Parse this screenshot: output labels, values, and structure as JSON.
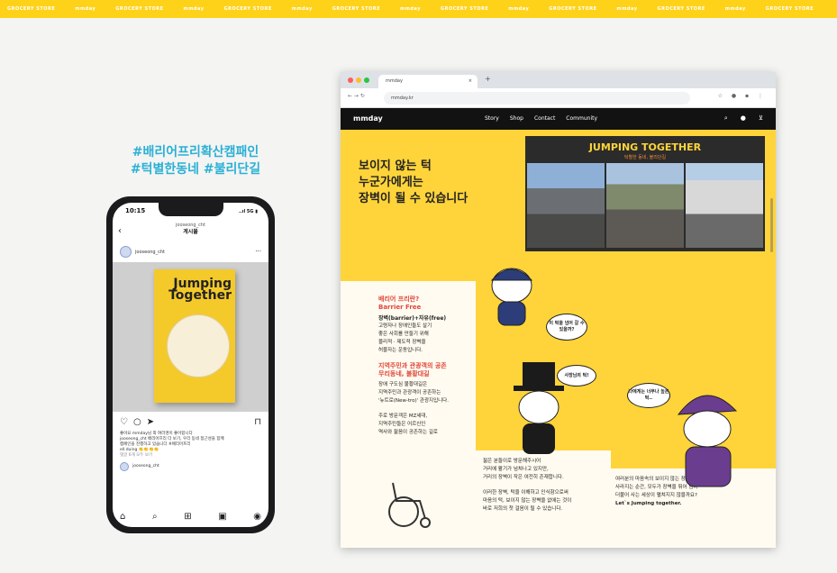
{
  "banner": {
    "items": [
      "GROCERY STORE",
      "mmday",
      "GROCERY STORE",
      "mmday",
      "GROCERY STORE",
      "mmday",
      "GROCERY STORE",
      "mmday",
      "GROCERY STORE",
      "mmday",
      "GROCERY STORE",
      "mmday",
      "GROCERY STORE",
      "mmday",
      "GROCERY STORE"
    ]
  },
  "campaign": {
    "line1": "#배리어프리확산캠패인",
    "line2": "#턱별한동네 #불리단길"
  },
  "phone": {
    "time": "10:15",
    "signal": "..ıl 5G ▮",
    "ig_account": "jooseong_cht",
    "ig_title": "게시물",
    "post_user": "jooseong_cht",
    "poster_title_1": "Jumping",
    "poster_title_2": "Together",
    "caption_1": "좋아요 mmday님 외 여러명이 좋아합니다",
    "caption_2": "jooseong_cht 배리어프리 더 보기, 우리 동네 접근성을 함께",
    "caption_3": "캠페인을 진행하고 있습니다 #배리어프리",
    "caption_4": "ell.duing 👏👏👏👏",
    "caption_5": "댓글 6개 모두 보기",
    "commenter": "jooseong_cht"
  },
  "browser": {
    "tab_title": "mmday",
    "url": "mmday.kr",
    "logo": "mmday",
    "nav": [
      "Story",
      "Shop",
      "Contact",
      "Community"
    ],
    "headline": [
      "보이지 않는 턱",
      "누군가에게는",
      "장벽이 될 수 있습니다"
    ],
    "photo_title": "JUMPING TOGETHER",
    "photo_sub": "턱별한 동네, 불리단길",
    "bf_title_1": "배리어 프리란?",
    "bf_title_2": "Barrier Free",
    "bf_def": "장벽(barrier)+자유(free)",
    "bf_body": [
      "고령자나 장애인들도 살기",
      "좋은 사회를 만들기 위해",
      "물리적 · 제도적 장벽을",
      "허물자는 운동입니다."
    ],
    "sec2_title_1": "지역주민과 관광객의 공존",
    "sec2_title_2": "무리동네, 불황대길",
    "sec2_body": [
      "장애 구도심 불황대길은",
      "지역주민과 관광객이 공존하는",
      "'뉴트로(New-tro)' 관광지입니다."
    ],
    "sec3_body": [
      "주로 방문객은 MZ세대,",
      "지역주민들은 어르신인",
      "역사와 젊음이 공존하는 길로"
    ],
    "mid1": [
      "젊은 분들이로 방문해주시어",
      "거리에 활기가 넘쳐나고 있지만,",
      "거리의 장벽이 작은 여전히 존재합니다."
    ],
    "mid2": [
      "이러한 장벽, 턱을 이해하고 인식함으로써",
      "마음의 턱, 보이지 않는 장벽을 없애는 것이",
      "바로 저희의 첫 걸음이 될 수 있습니다."
    ],
    "right_text": [
      "여러분의 마음속의 보이지 않는 장벽이",
      "사라지는 순간, 모두가 장벽을 뛰어 넘어",
      "더불어 사는 세상이 펼쳐지지 않을까요?",
      "Let`s Jumping together."
    ],
    "bubble1": "이 턱을 넘어 갈 수 있을까?",
    "bubble2": "사장님의 턱!",
    "bubble3": "나에게는 너무나 높은 턱..",
    "colors": {
      "yellow": "#ffd43a",
      "nav": "#121212",
      "accent_red": "#e0463a"
    }
  }
}
